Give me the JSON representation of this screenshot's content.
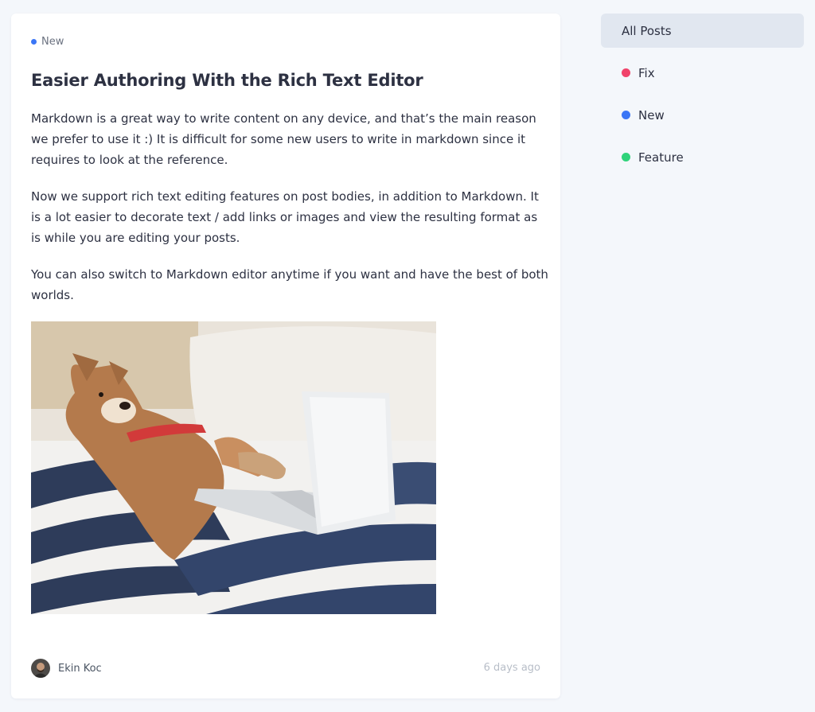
{
  "post": {
    "tag": {
      "label": "New",
      "color": "#3b76f6"
    },
    "title": "Easier Authoring With the Rich Text Editor",
    "paragraphs": [
      "Markdown is a great way to write content on any device, and that’s the main reason we prefer to use it :) It is difficult for some new users to write in markdown since it requires to look at the reference.",
      "Now we support rich text editing features on post bodies, in addition to Markdown. It is a lot easier to decorate text / add links or images and view the resulting format as is while you are editing your posts.",
      "You can also switch to Markdown editor anytime if you want and have the best of both worlds."
    ],
    "author": {
      "name": "Ekin Koc"
    },
    "timestamp": "6 days ago"
  },
  "sidebar": {
    "items": [
      {
        "label": "All Posts",
        "active": true
      },
      {
        "label": "Fix",
        "color": "#f0436a"
      },
      {
        "label": "New",
        "color": "#3b76f6"
      },
      {
        "label": "Feature",
        "color": "#2fd37a"
      }
    ]
  }
}
